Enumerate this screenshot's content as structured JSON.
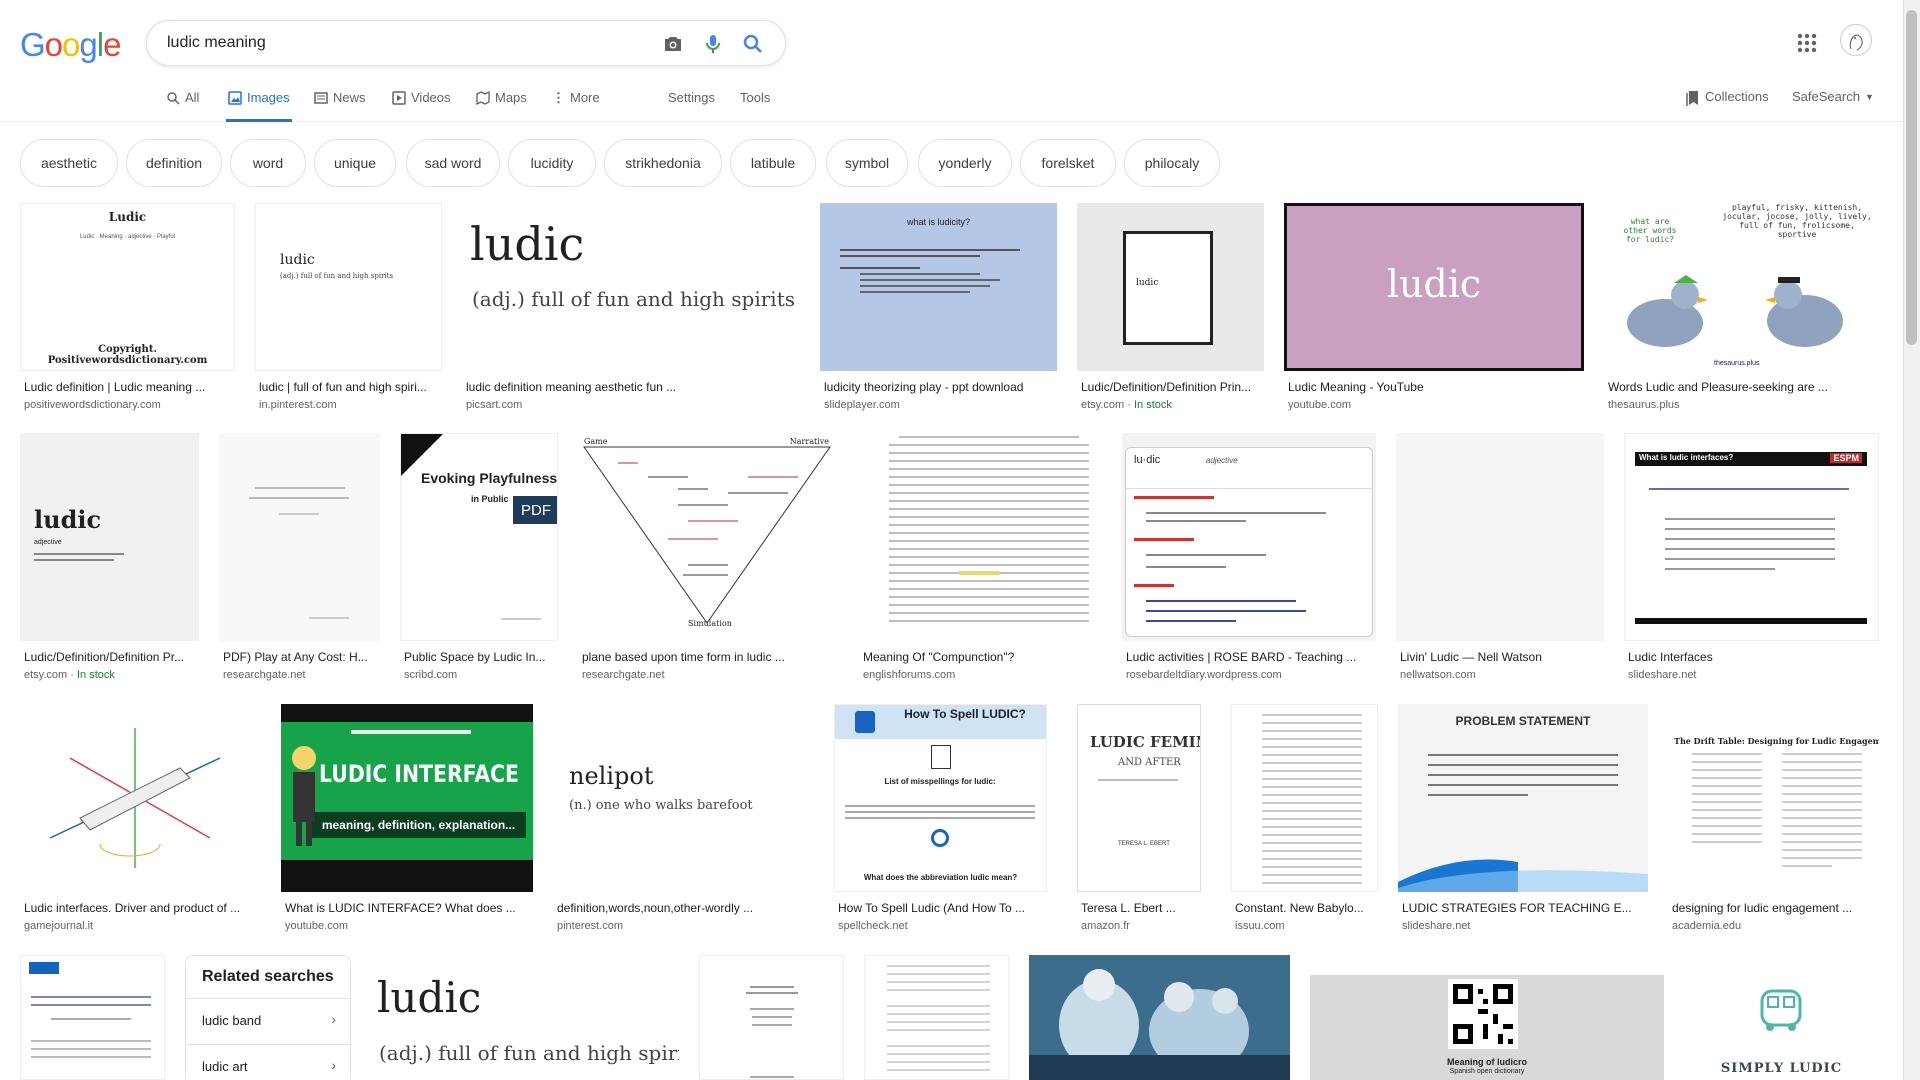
{
  "logo": {
    "letters": [
      "G",
      "o",
      "o",
      "g",
      "l",
      "e"
    ],
    "colors": [
      "#4285f4",
      "#ea4335",
      "#fbbc05",
      "#4285f4",
      "#34a853",
      "#ea4335"
    ]
  },
  "search": {
    "value": "ludic meaning"
  },
  "tabs": {
    "all": "All",
    "images": "Images",
    "news": "News",
    "videos": "Videos",
    "maps": "Maps",
    "more": "More",
    "settings": "Settings",
    "tools": "Tools",
    "collections": "Collections",
    "safesearch": "SafeSearch"
  },
  "chips": [
    "aesthetic",
    "definition",
    "word",
    "unique",
    "sad word",
    "lucidity",
    "strikhedonia",
    "latibule",
    "symbol",
    "yonderly",
    "forelsket",
    "philocaly"
  ],
  "results": [
    {
      "title": "Ludic definition | Ludic meaning ...",
      "source": "positivewordsdictionary.com"
    },
    {
      "title": "ludic | full of fun and high spiri...",
      "source": "in.pinterest.com"
    },
    {
      "title": "ludic definition meaning aesthetic fun ...",
      "source": "picsart.com"
    },
    {
      "title": "ludicity theorizing play - ppt download",
      "source": "slideplayer.com"
    },
    {
      "title": "Ludic/Definition/Definition Prin...",
      "source": "etsy.com",
      "extra": "In stock"
    },
    {
      "title": "Ludic Meaning - YouTube",
      "source": "youtube.com"
    },
    {
      "title": "Words Ludic and Pleasure-seeking are ...",
      "source": "thesaurus.plus"
    },
    {
      "title": "Ludic/Definition/Definition Pr...",
      "source": "etsy.com",
      "extra": "In stock"
    },
    {
      "title": "PDF) Play at Any Cost: H...",
      "source": "researchgate.net"
    },
    {
      "title": "Public Space by Ludic In...",
      "source": "scribd.com"
    },
    {
      "title": "plane based upon time form in ludic ...",
      "source": "researchgate.net"
    },
    {
      "title": "Meaning Of \"Compunction\"?",
      "source": "englishforums.com"
    },
    {
      "title": "Ludic activities | ROSE BARD - Teaching ...",
      "source": "rosebardeltdiary.wordpress.com"
    },
    {
      "title": "Livin' Ludic — Nell Watson",
      "source": "nellwatson.com"
    },
    {
      "title": "Ludic Interfaces",
      "source": "slideshare.net"
    },
    {
      "title": "Ludic interfaces. Driver and product of ...",
      "source": "gamejournal.it"
    },
    {
      "title": "What is LUDIC INTERFACE? What does ...",
      "source": "youtube.com"
    },
    {
      "title": "definition,words,noun,other-wordly ...",
      "source": "pinterest.com"
    },
    {
      "title": "How To Spell Ludic (And How To ...",
      "source": "spellcheck.net"
    },
    {
      "title": "Teresa L. Ebert ...",
      "source": "amazon.fr"
    },
    {
      "title": "Constant. New Babylo...",
      "source": "issuu.com"
    },
    {
      "title": "LUDIC STRATEGIES FOR TEACHING E...",
      "source": "slideshare.net"
    },
    {
      "title": "designing for ludic engagement ...",
      "source": "academia.edu"
    }
  ],
  "thumbs": {
    "t1_word": "Ludic",
    "t1_sub": "Ludic · Meaning · adjective · Playful",
    "t1_foot": "Copyright.  Positivewordsdictionary.com",
    "t2_word": "ludic",
    "t2_def": "(adj.) full of fun and high spirits",
    "t3_word": "ludic",
    "t3_def": "(adj.) full of fun and high spirits",
    "t4_q": "what is ludicity?",
    "t5_word": "ludic",
    "t6_word": "ludic",
    "t7_q": "what are other words for ludic?",
    "t7_syn": "playful, frisky, kittenish, jocular, jocose, jolly, lively, full of fun, frolicsome, sportive",
    "t7_brand": "thesaurus.plus",
    "t8_word": "ludic",
    "t8_pos": "adjective",
    "t10_title": "Evoking Playfulness",
    "t10_sub": "in Public",
    "t10_badge": "PDF",
    "t11_game": "Game",
    "t11_narr": "Narrative",
    "t11_sim": "Simulation",
    "t13_word": "lu·dic",
    "t13_pos": "adjective",
    "t15_q": "What is ludic interfaces?",
    "t15_brand": "ESPM",
    "t17_title": "LUDIC INTERFACE",
    "t17_sub": "meaning, definition, explanation...",
    "t18_word": "nelipot",
    "t18_def": "(n.) one who walks barefoot",
    "t19_title": "How To Spell LUDIC?",
    "t19_sub": "List of misspellings for ludic:",
    "t19_foot": "What does the abbreviation ludic mean?",
    "t20_title": "LUDIC FEMINISM",
    "t20_sub": "AND AFTER",
    "t20_author": "TERESA L. EBERT",
    "t22_title": "PROBLEM STATEMENT",
    "t23_title": "The Drift Table: Designing for Ludic Engagement",
    "b3_word": "ludic",
    "b3_def": "(adj.) full of fun and high spirits",
    "b7_caption": "Meaning of ludicro",
    "b7_sub": "Spanish open dictionary",
    "b8_brand": "SIMPLY LUDIC"
  },
  "related": {
    "title": "Related searches",
    "items": [
      "ludic band",
      "ludic art"
    ]
  }
}
